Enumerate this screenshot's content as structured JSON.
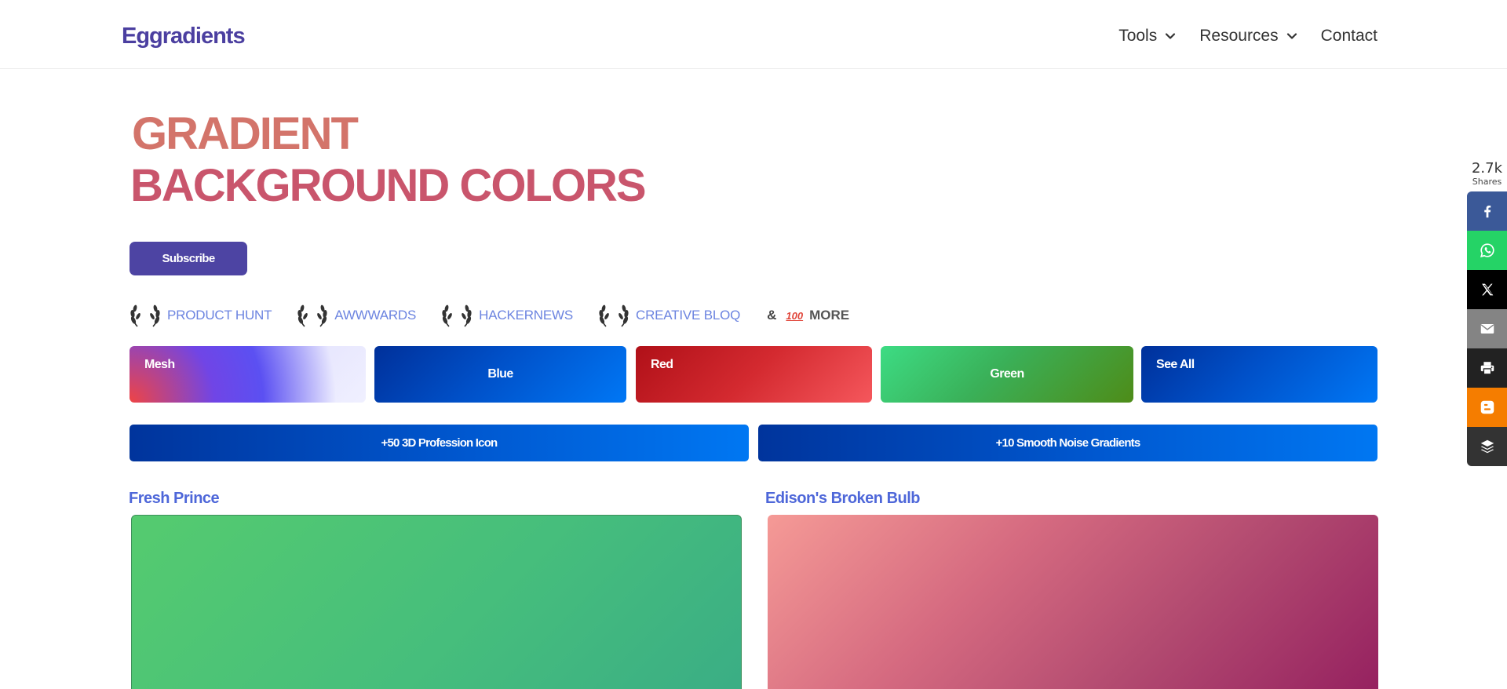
{
  "header": {
    "logo": "Eggradients",
    "nav": [
      {
        "label": "Tools",
        "has_dropdown": true
      },
      {
        "label": "Resources",
        "has_dropdown": true
      },
      {
        "label": "Contact",
        "has_dropdown": false
      }
    ]
  },
  "hero": {
    "title_line1": "GRADIENT",
    "title_line2": "BACKGROUND COLORS",
    "subscribe_label": "Subscribe"
  },
  "awards": {
    "items": [
      "PRODUCT HUNT",
      "AWWWARDS",
      "HACKERNEWS",
      "CREATIVE BLOQ"
    ],
    "more_prefix": "&",
    "more_emoji": "100",
    "more_label": "MORE"
  },
  "categories": [
    {
      "label": "Mesh"
    },
    {
      "label": "Blue"
    },
    {
      "label": "Red"
    },
    {
      "label": "Green"
    },
    {
      "label": "See All"
    }
  ],
  "promos": [
    {
      "label": "+50 3D Profession Icon"
    },
    {
      "label": "+10 Smooth Noise Gradients"
    }
  ],
  "gradients": [
    {
      "title": "Fresh Prince"
    },
    {
      "title": "Edison's Broken Bulb"
    }
  ],
  "share": {
    "count": "2.7k",
    "label": "Shares",
    "buttons": [
      "facebook-icon",
      "whatsapp-icon",
      "x-icon",
      "email-icon",
      "print-icon",
      "blogger-icon",
      "buffer-icon"
    ]
  },
  "colors": {
    "brand": "#4b3fa0",
    "title_line1": "#d3746a",
    "title_line2": "#c9556c",
    "link": "#6c84e0",
    "card_title": "#4e67d9"
  }
}
